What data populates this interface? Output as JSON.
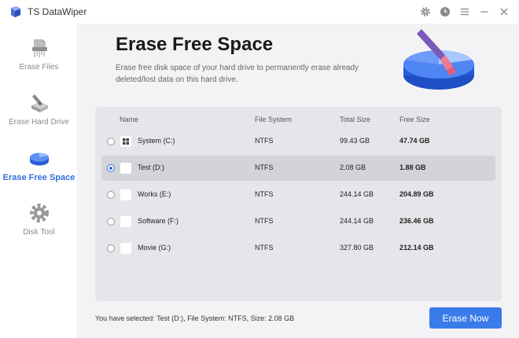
{
  "app": {
    "title": "TS DataWiper"
  },
  "sidebar": {
    "items": [
      {
        "label": "Erase Files",
        "icon": "file-shred-icon",
        "active": false
      },
      {
        "label": "Erase Hard Drive",
        "icon": "hard-drive-erase-icon",
        "active": false
      },
      {
        "label": "Erase Free Space",
        "icon": "pie-disk-icon",
        "active": true
      },
      {
        "label": "Disk Tool",
        "icon": "gear-icon",
        "active": false
      }
    ]
  },
  "main": {
    "title": "Erase Free Space",
    "description": "Erase free disk space of your hard drive to permanently erase already deleted/lost data on this hard drive."
  },
  "table": {
    "headers": {
      "name": "Name",
      "file_system": "File System",
      "total_size": "Total Size",
      "free_size": "Free Size"
    },
    "rows": [
      {
        "name": "System (C:)",
        "file_system": "NTFS",
        "total_size": "99.43 GB",
        "free_size": "47.74 GB",
        "selected": false,
        "icon": "windows-drive-icon"
      },
      {
        "name": "Test (D:)",
        "file_system": "NTFS",
        "total_size": "2.08 GB",
        "free_size": "1.88 GB",
        "selected": true,
        "icon": "drive-icon"
      },
      {
        "name": "Works (E:)",
        "file_system": "NTFS",
        "total_size": "244.14 GB",
        "free_size": "204.89 GB",
        "selected": false,
        "icon": "drive-icon"
      },
      {
        "name": "Software (F:)",
        "file_system": "NTFS",
        "total_size": "244.14 GB",
        "free_size": "236.46 GB",
        "selected": false,
        "icon": "drive-icon"
      },
      {
        "name": "Movie (G:)",
        "file_system": "NTFS",
        "total_size": "327.80 GB",
        "free_size": "212.14 GB",
        "selected": false,
        "icon": "drive-icon"
      }
    ]
  },
  "footer": {
    "status": "You have selected: Test (D:), File System: NTFS, Size: 2.08 GB",
    "erase_label": "Erase Now"
  },
  "colors": {
    "accent": "#3a7bea",
    "sidebar_active": "#2f6fe0",
    "panel_bg": "#e6e6ea",
    "selected_row": "#d3d3da",
    "main_bg": "#f3f3f6"
  }
}
